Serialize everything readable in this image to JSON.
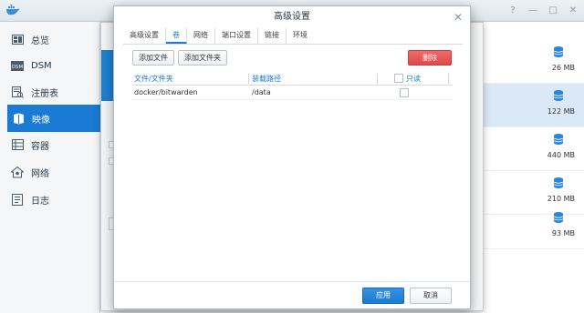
{
  "window": {
    "controls": [
      "?",
      "—",
      "□",
      "✕"
    ]
  },
  "sidebar": {
    "items": [
      {
        "label": "总览",
        "icon": "overview-icon",
        "active": false
      },
      {
        "label": "DSM",
        "icon": "dsm-icon",
        "active": false
      },
      {
        "label": "注册表",
        "icon": "registry-icon",
        "active": false
      },
      {
        "label": "映像",
        "icon": "image-icon",
        "active": true
      },
      {
        "label": "容器",
        "icon": "container-icon",
        "active": false
      },
      {
        "label": "网络",
        "icon": "network-icon",
        "active": false
      },
      {
        "label": "日志",
        "icon": "log-icon",
        "active": false
      }
    ]
  },
  "images": {
    "sizes": [
      "26 MB",
      "122 MB",
      "440 MB",
      "210 MB",
      "93 MB"
    ],
    "selected_index": 1
  },
  "dialog": {
    "title": "高级设置",
    "close": "✕",
    "tabs": [
      "高级设置",
      "卷",
      "网络",
      "端口设置",
      "链接",
      "环境"
    ],
    "active_tab": 1,
    "buttons": {
      "add_file": "添加文件",
      "add_folder": "添加文件夹",
      "delete": "删除"
    },
    "table": {
      "headers": {
        "file_folder": "文件/文件夹",
        "mount_path": "装载路径",
        "readonly": "只读"
      },
      "rows": [
        {
          "file_folder": "docker/bitwarden",
          "mount_path": "/data",
          "readonly": false
        }
      ]
    },
    "footer": {
      "apply": "应用",
      "cancel": "取消"
    }
  },
  "colors": {
    "accent": "#1a7bd4",
    "danger": "#df4a4a",
    "sidebar_bg": "#f4f6f8"
  }
}
